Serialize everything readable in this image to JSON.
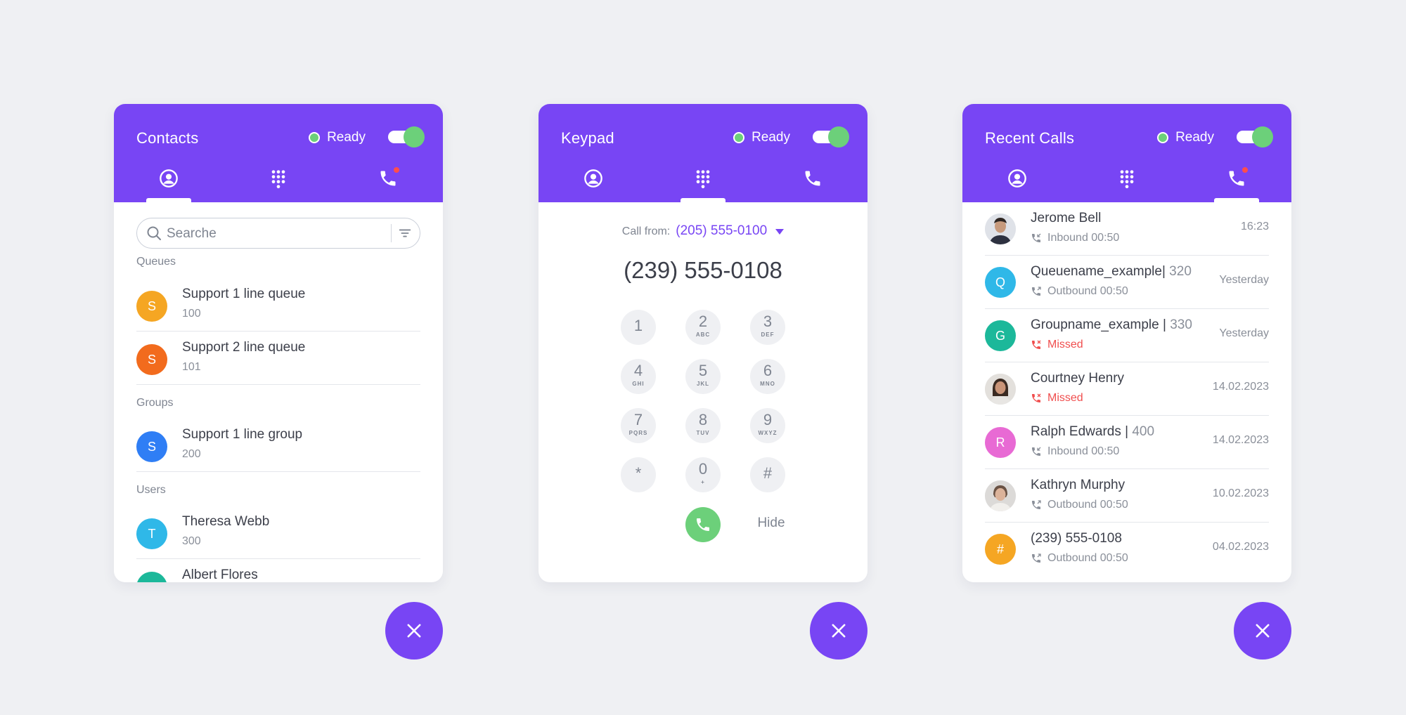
{
  "status_label": "Ready",
  "colors": {
    "accent": "#7845f4",
    "ready": "#6cd07a",
    "missed": "#f04e4e"
  },
  "contacts": {
    "title": "Contacts",
    "search_placeholder": "Searche",
    "sections": {
      "queues": "Queues",
      "groups": "Groups",
      "users": "Users"
    },
    "queues": [
      {
        "initial": "S",
        "name": "Support 1 line queue",
        "number": "100",
        "color": "#f5a623"
      },
      {
        "initial": "S",
        "name": "Support 2 line queue",
        "number": "101",
        "color": "#f26b1d"
      }
    ],
    "groups": [
      {
        "initial": "S",
        "name": "Support 1 line group",
        "number": "200",
        "color": "#2f7ef5"
      }
    ],
    "users": [
      {
        "initial": "T",
        "name": "Theresa Webb",
        "number": "300",
        "color": "#2fb8e8"
      },
      {
        "initial": "A",
        "name": "Albert Flores",
        "number": "",
        "color": "#1cb89a"
      }
    ]
  },
  "keypad": {
    "title": "Keypad",
    "call_from_label": "Call from:",
    "call_from_number": "(205) 555-0100",
    "dialed_number": "(239) 555-0108",
    "keys": [
      {
        "digit": "1",
        "letters": ""
      },
      {
        "digit": "2",
        "letters": "ABC"
      },
      {
        "digit": "3",
        "letters": "DEF"
      },
      {
        "digit": "4",
        "letters": "GHI"
      },
      {
        "digit": "5",
        "letters": "JKL"
      },
      {
        "digit": "6",
        "letters": "MNO"
      },
      {
        "digit": "7",
        "letters": "PQRS"
      },
      {
        "digit": "8",
        "letters": "TUV"
      },
      {
        "digit": "9",
        "letters": "WXYZ"
      },
      {
        "digit": "*",
        "letters": ""
      },
      {
        "digit": "0",
        "letters": "+"
      },
      {
        "digit": "#",
        "letters": ""
      }
    ],
    "hide_label": "Hide"
  },
  "recent": {
    "title": "Recent Calls",
    "calls": [
      {
        "avatar": "photo",
        "initial": "",
        "color": "#6f7890",
        "name": "Jerome Bell",
        "ext": "",
        "type": "inbound",
        "detail": "Inbound 00:50",
        "time": "16:23"
      },
      {
        "avatar": "initial",
        "initial": "Q",
        "color": "#2fb8e8",
        "name": "Queuename_example|",
        "ext": " 320",
        "type": "outbound",
        "detail": "Outbound 00:50",
        "time": "Yesterday"
      },
      {
        "avatar": "initial",
        "initial": "G",
        "color": "#1cb89a",
        "name": "Groupname_example |",
        "ext": " 330",
        "type": "missed",
        "detail": "Missed",
        "time": "Yesterday"
      },
      {
        "avatar": "photo",
        "initial": "",
        "color": "#8a6a55",
        "name": "Courtney Henry",
        "ext": "",
        "type": "missed",
        "detail": "Missed",
        "time": "14.02.2023"
      },
      {
        "avatar": "initial",
        "initial": "R",
        "color": "#e86ad4",
        "name": "Ralph Edwards |",
        "ext": " 400",
        "type": "inbound",
        "detail": "Inbound 00:50",
        "time": "14.02.2023"
      },
      {
        "avatar": "photo",
        "initial": "",
        "color": "#9a8f86",
        "name": "Kathryn Murphy",
        "ext": "",
        "type": "outbound",
        "detail": "Outbound 00:50",
        "time": "10.02.2023"
      },
      {
        "avatar": "initial",
        "initial": "#",
        "color": "#f5a623",
        "name": "(239) 555-0108",
        "ext": "",
        "type": "outbound",
        "detail": "Outbound 00:50",
        "time": "04.02.2023"
      }
    ]
  }
}
